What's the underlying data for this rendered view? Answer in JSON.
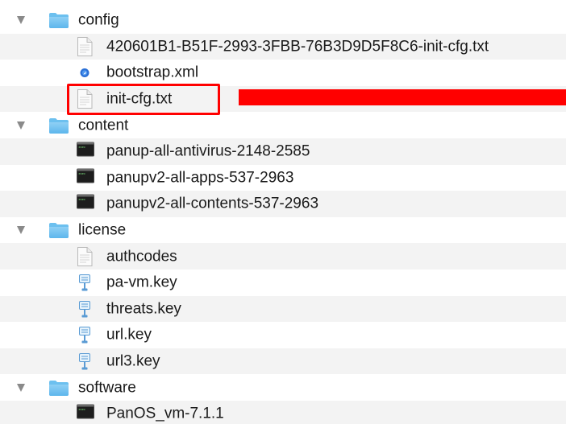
{
  "accent_red": "#ff0000",
  "folders": [
    {
      "name": "config",
      "expanded": true,
      "children": [
        {
          "name": "420601B1-B51F-2993-3FBB-76B3D9D5F8C6-init-cfg.txt",
          "icon": "text-document-icon"
        },
        {
          "name": "bootstrap.xml",
          "icon": "xml-document-icon"
        },
        {
          "name": "init-cfg.txt",
          "icon": "text-document-icon",
          "highlighted": true
        }
      ]
    },
    {
      "name": "content",
      "expanded": true,
      "children": [
        {
          "name": "panup-all-antivirus-2148-2585",
          "icon": "terminal-executable-icon"
        },
        {
          "name": "panupv2-all-apps-537-2963",
          "icon": "terminal-executable-icon"
        },
        {
          "name": "panupv2-all-contents-537-2963",
          "icon": "terminal-executable-icon"
        }
      ]
    },
    {
      "name": "license",
      "expanded": true,
      "children": [
        {
          "name": "authcodes",
          "icon": "text-document-icon"
        },
        {
          "name": "pa-vm.key",
          "icon": "key-document-icon"
        },
        {
          "name": "threats.key",
          "icon": "key-document-icon"
        },
        {
          "name": "url.key",
          "icon": "key-document-icon"
        },
        {
          "name": "url3.key",
          "icon": "key-document-icon"
        }
      ]
    },
    {
      "name": "software",
      "expanded": true,
      "children": [
        {
          "name": "PanOS_vm-7.1.1",
          "icon": "terminal-executable-icon"
        }
      ]
    }
  ]
}
